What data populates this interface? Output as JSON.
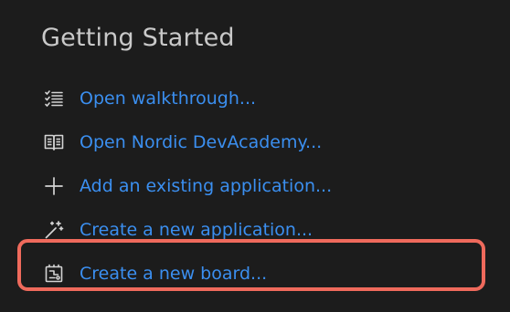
{
  "section": {
    "title": "Getting Started"
  },
  "items": [
    {
      "label": "Open walkthrough...",
      "icon": "list-icon"
    },
    {
      "label": "Open Nordic DevAcademy...",
      "icon": "book-icon"
    },
    {
      "label": "Add an existing application...",
      "icon": "plus-icon"
    },
    {
      "label": "Create a new application...",
      "icon": "magic-wand-icon"
    },
    {
      "label": "Create a new board...",
      "icon": "board-icon"
    }
  ],
  "colors": {
    "background": "#1c1c1c",
    "title": "#c9c9c9",
    "link": "#3b8ff0",
    "icon": "#d4d4d4",
    "highlight": "#ef6a5c"
  }
}
